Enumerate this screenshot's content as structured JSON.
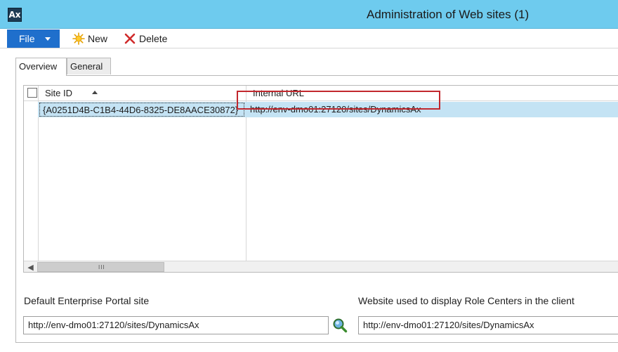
{
  "window": {
    "app_icon_text": "Ax",
    "title": "Administration of Web sites (1)"
  },
  "toolbar": {
    "file_label": "File",
    "new_label": "New",
    "delete_label": "Delete"
  },
  "tabs": [
    {
      "label": "Overview",
      "active": true
    },
    {
      "label": "General",
      "active": false
    }
  ],
  "grid": {
    "columns": [
      "Site ID",
      "Internal URL"
    ],
    "sort": {
      "column": "Site ID",
      "direction": "ascending"
    },
    "rows": [
      {
        "site_id": "{A0251D4B-C1B4-44D6-8325-DE8AACE30872}",
        "internal_url": "http://env-dmo01:27120/sites/DynamicsAx"
      }
    ],
    "scrollbar_grip": "III"
  },
  "fields": {
    "default_portal": {
      "label": "Default Enterprise Portal site",
      "value": "http://env-dmo01:27120/sites/DynamicsAx"
    },
    "role_centers": {
      "label": "Website used to display Role Centers in the client",
      "value": "http://env-dmo01:27120/sites/DynamicsAx"
    }
  },
  "colors": {
    "titlebar": "#6ecbee",
    "file_button": "#1f6fcc",
    "selected_row": "#c4e3f4",
    "highlight_box": "#c2272d"
  },
  "icons": {
    "new": "sun-star-icon",
    "delete": "red-x-icon",
    "lookup": "magnifier-lookup-icon"
  }
}
